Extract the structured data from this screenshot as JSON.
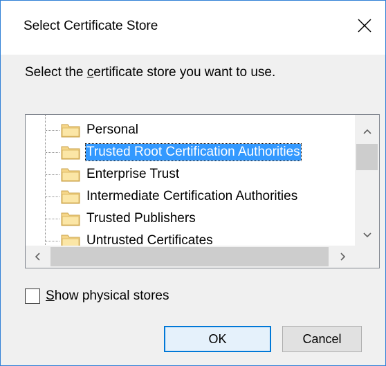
{
  "window": {
    "title": "Select Certificate Store",
    "close_icon": "close-icon"
  },
  "instruction": {
    "before": "Select the ",
    "accel": "c",
    "after": "ertificate store you want to use."
  },
  "tree": {
    "items": [
      {
        "label": "Personal",
        "selected": false
      },
      {
        "label": "Trusted Root Certification Authorities",
        "selected": true
      },
      {
        "label": "Enterprise Trust",
        "selected": false
      },
      {
        "label": "Intermediate Certification Authorities",
        "selected": false
      },
      {
        "label": "Trusted Publishers",
        "selected": false
      },
      {
        "label": "Untrusted Certificates",
        "selected": false
      }
    ],
    "folder_color": "#f5d68a"
  },
  "checkbox": {
    "accel": "S",
    "rest": "how physical stores",
    "checked": false
  },
  "buttons": {
    "ok": "OK",
    "cancel": "Cancel"
  },
  "colors": {
    "selection": "#3399ff",
    "accent": "#0078d7",
    "border": "#2f7fd6"
  }
}
